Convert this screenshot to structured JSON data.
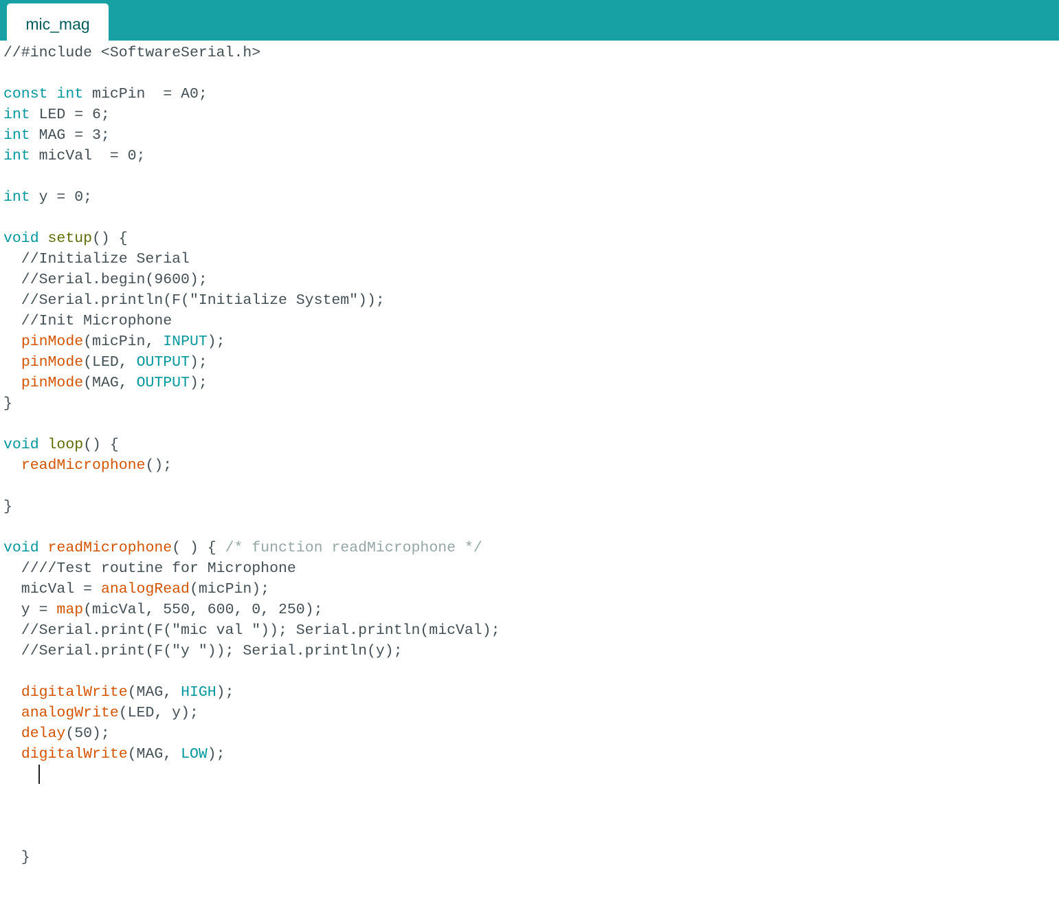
{
  "tab": {
    "label": "mic_mag"
  },
  "colors": {
    "tab_bar": "#17a1a5",
    "tab_text": "#005c5f",
    "plain": "#434f54",
    "type_keyword": "#00979d",
    "function": "#d35400",
    "structure": "#5e6d03",
    "block_comment": "#95a5a6"
  },
  "code": {
    "lines": [
      [
        {
          "t": "//#include <SoftwareSerial.h>",
          "c": "comment"
        }
      ],
      [],
      [
        {
          "t": "const",
          "c": "type"
        },
        {
          "t": " "
        },
        {
          "t": "int",
          "c": "type"
        },
        {
          "t": " micPin  = A0;"
        }
      ],
      [
        {
          "t": "int",
          "c": "type"
        },
        {
          "t": " LED = 6;"
        }
      ],
      [
        {
          "t": "int",
          "c": "type"
        },
        {
          "t": " MAG = 3;"
        }
      ],
      [
        {
          "t": "int",
          "c": "type"
        },
        {
          "t": " micVal  = 0;"
        }
      ],
      [],
      [
        {
          "t": "int",
          "c": "type"
        },
        {
          "t": " y = 0;"
        }
      ],
      [],
      [
        {
          "t": "void",
          "c": "type"
        },
        {
          "t": " "
        },
        {
          "t": "setup",
          "c": "struct"
        },
        {
          "t": "() {"
        }
      ],
      [
        {
          "t": "  //Initialize Serial",
          "c": "comment"
        }
      ],
      [
        {
          "t": "  //Serial.begin(9600);",
          "c": "comment"
        }
      ],
      [
        {
          "t": "  //Serial.println(F(\"Initialize System\"));",
          "c": "comment"
        }
      ],
      [
        {
          "t": "  //Init Microphone",
          "c": "comment"
        }
      ],
      [
        {
          "t": "  "
        },
        {
          "t": "pinMode",
          "c": "func"
        },
        {
          "t": "(micPin, "
        },
        {
          "t": "INPUT",
          "c": "const"
        },
        {
          "t": ");"
        }
      ],
      [
        {
          "t": "  "
        },
        {
          "t": "pinMode",
          "c": "func"
        },
        {
          "t": "(LED, "
        },
        {
          "t": "OUTPUT",
          "c": "const"
        },
        {
          "t": ");"
        }
      ],
      [
        {
          "t": "  "
        },
        {
          "t": "pinMode",
          "c": "func"
        },
        {
          "t": "(MAG, "
        },
        {
          "t": "OUTPUT",
          "c": "const"
        },
        {
          "t": ");"
        }
      ],
      [
        {
          "t": "}"
        }
      ],
      [],
      [
        {
          "t": "void",
          "c": "type"
        },
        {
          "t": " "
        },
        {
          "t": "loop",
          "c": "struct"
        },
        {
          "t": "() {"
        }
      ],
      [
        {
          "t": "  "
        },
        {
          "t": "readMicrophone",
          "c": "func"
        },
        {
          "t": "();"
        }
      ],
      [],
      [
        {
          "t": "}"
        }
      ],
      [],
      [
        {
          "t": "void",
          "c": "type"
        },
        {
          "t": " "
        },
        {
          "t": "readMicrophone",
          "c": "func"
        },
        {
          "t": "( ) { "
        },
        {
          "t": "/* function readMicrophone */",
          "c": "block"
        }
      ],
      [
        {
          "t": "  ////Test routine for Microphone",
          "c": "comment"
        }
      ],
      [
        {
          "t": "  micVal = "
        },
        {
          "t": "analogRead",
          "c": "func"
        },
        {
          "t": "(micPin);"
        }
      ],
      [
        {
          "t": "  y = "
        },
        {
          "t": "map",
          "c": "func"
        },
        {
          "t": "(micVal, 550, 600, 0, 250);"
        }
      ],
      [
        {
          "t": "  //Serial.print(F(\"mic val \")); Serial.println(micVal);",
          "c": "comment"
        }
      ],
      [
        {
          "t": "  //Serial.print(F(\"y \")); Serial.println(y);",
          "c": "comment"
        }
      ],
      [],
      [
        {
          "t": "  "
        },
        {
          "t": "digitalWrite",
          "c": "func"
        },
        {
          "t": "(MAG, "
        },
        {
          "t": "HIGH",
          "c": "const"
        },
        {
          "t": ");"
        }
      ],
      [
        {
          "t": "  "
        },
        {
          "t": "analogWrite",
          "c": "func"
        },
        {
          "t": "(LED, y);"
        }
      ],
      [
        {
          "t": "  "
        },
        {
          "t": "delay",
          "c": "func"
        },
        {
          "t": "(50);"
        }
      ],
      [
        {
          "t": "  "
        },
        {
          "t": "digitalWrite",
          "c": "func"
        },
        {
          "t": "(MAG, "
        },
        {
          "t": "LOW",
          "c": "const"
        },
        {
          "t": ");"
        }
      ],
      [],
      [],
      [],
      [],
      [
        {
          "t": "  }"
        }
      ]
    ]
  }
}
